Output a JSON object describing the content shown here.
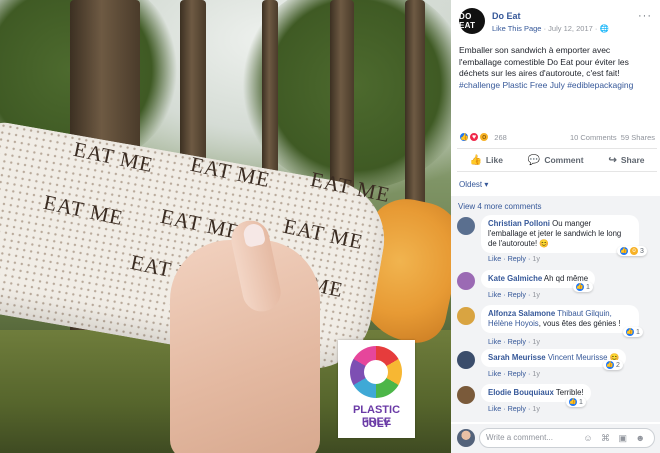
{
  "photo": {
    "wrapper_text": "EAT ME",
    "badge_text_line1": "PLASTIC FREE",
    "badge_text_line2": "JULY"
  },
  "post": {
    "page_avatar_text": "DO EAT",
    "page_name": "Do Eat",
    "like_page": "Like This Page",
    "separator": "·",
    "date": "July 12, 2017",
    "audience_icon": "globe-icon",
    "more": "···",
    "text": "Emballer son sandwich à emporter avec l'emballage comestible Do Eat pour éviter les déchets sur les aires d'autoroute, c'est fait!",
    "hashtags": "#challenge Plastic Free July #ediblepackaging",
    "reaction_count": "268",
    "comments_count": "10 Comments",
    "shares_count": "59 Shares",
    "actions": {
      "like": "Like",
      "comment": "Comment",
      "share": "Share"
    },
    "sort": "Oldest ▾"
  },
  "comments_header": {
    "view_more": "View 4 more comments"
  },
  "comments": [
    {
      "name": "Christian Polloni",
      "text": "Ou manger l'emballage et jeter le sandwich le long de l'autoroute!",
      "emoji": "😊",
      "like": "Like",
      "reply": "Reply",
      "time": "1y",
      "reactions": "3",
      "avatar_color": "#5a6f8f"
    },
    {
      "name": "Kate Galmiche",
      "text": "Ah qd même",
      "like": "Like",
      "reply": "Reply",
      "time": "1y",
      "reactions": "1",
      "avatar_color": "#9b6ab4"
    },
    {
      "name": "Alfonza Salamone",
      "mention": "Thibaut Gilquin, Hélène Hoyois",
      "text": ", vous êtes des génies !",
      "like": "Like",
      "reply": "Reply",
      "time": "1y",
      "reactions": "1",
      "avatar_color": "#d9a441"
    },
    {
      "name": "Sarah Meurisse",
      "mention": "Vincent Meurisse",
      "emoji": "😊",
      "like": "Like",
      "reply": "Reply",
      "time": "1y",
      "reactions": "2",
      "avatar_color": "#3b4d6b"
    },
    {
      "name": "Elodie Bouquiaux",
      "text": "Terrible!",
      "like": "Like",
      "reply": "Reply",
      "time": "1y",
      "reactions": "1",
      "avatar_color": "#7a5a3a"
    }
  ],
  "composer": {
    "placeholder": "Write a comment...",
    "icons": "☺ ⌘ ▣ ☻"
  },
  "colors": {
    "link": "#365899",
    "muted": "#90949c",
    "like_blue": "#2078f4",
    "love_red": "#f0284a",
    "wow_yellow": "#f7b125"
  }
}
